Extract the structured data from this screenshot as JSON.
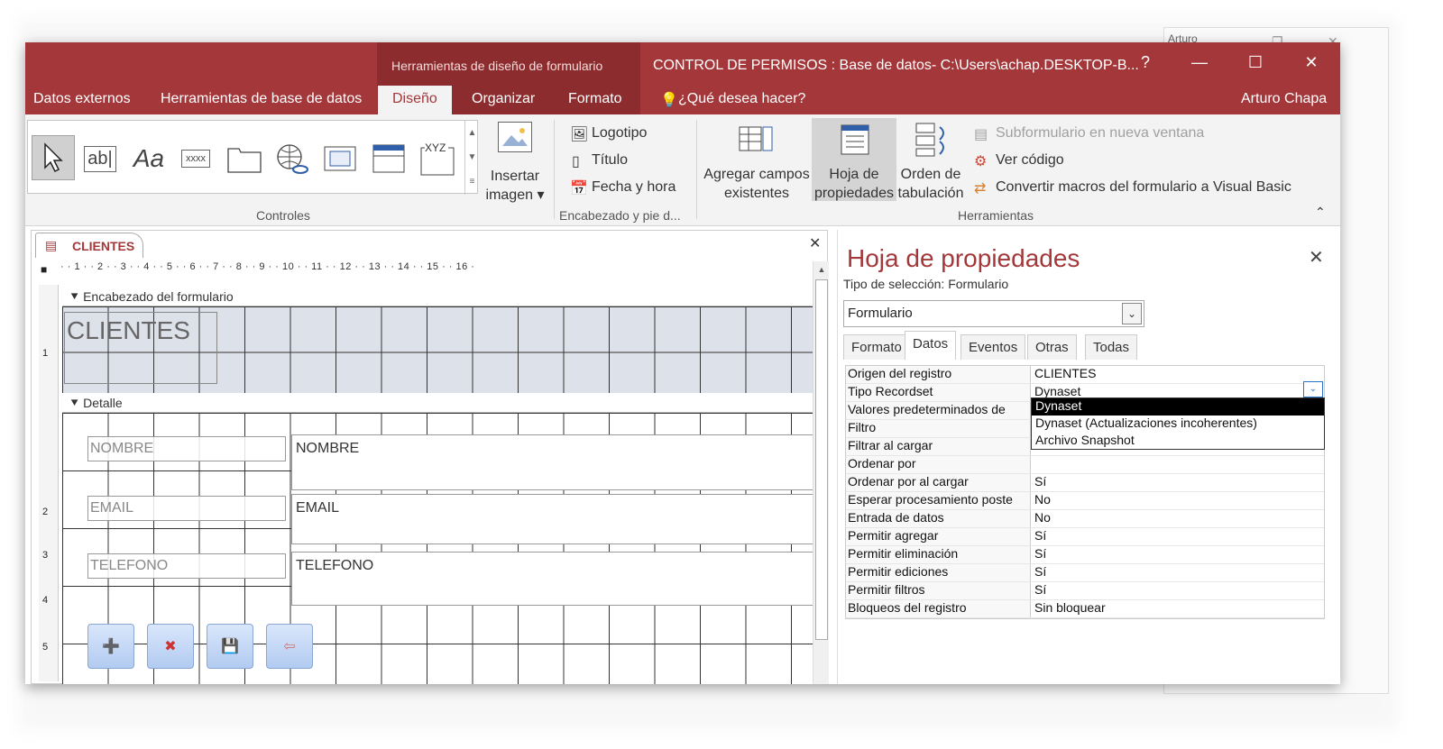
{
  "background_window": {
    "title": "Arturo",
    "controls": [
      "—",
      "❐",
      "✕"
    ]
  },
  "titlebar": {
    "context_label": "Herramientas de diseño de formulario",
    "document_title": "CONTROL DE PERMISOS : Base de datos- C:\\Users\\achap.DESKTOP-B...",
    "help": "?",
    "minimize": "—",
    "maximize": "☐",
    "close": "✕"
  },
  "tabs": {
    "datos_externos": "Datos externos",
    "herramientas_bd": "Herramientas de base de datos",
    "diseno": "Diseño",
    "organizar": "Organizar",
    "formato": "Formato",
    "que_desea": "¿Qué desea hacer?",
    "user": "Arturo Chapa"
  },
  "ribbon": {
    "controles_label": "Controles",
    "textbox_glyph": "ab|",
    "label_glyph": "Aa",
    "button_glyph": "xxxx",
    "xyz_glyph": "XYZ",
    "insertar_imagen": "Insertar imagen ▾",
    "logotipo": "Logotipo",
    "titulo": "Título",
    "fecha_hora": "Fecha y hora",
    "encabezado_label": "Encabezado y pie d...",
    "agregar_campos": "Agregar campos existentes",
    "hoja_propiedades": "Hoja de propiedades",
    "orden_tabulacion": "Orden de tabulación",
    "subformulario": "Subformulario en nueva ventana",
    "ver_codigo": "Ver código",
    "convertir_macros": "Convertir macros del formulario a Visual Basic",
    "herramientas_label": "Herramientas",
    "collapse": "⌃"
  },
  "designer": {
    "tab_label": "CLIENTES",
    "close": "✕",
    "ruler": "· · 1 · · 2 · · 3 · · 4 · · 5 · · 6 · · 7 · · 8 · · 9 · · 10 · · 11 · · 12 · · 13 · · 14 · · 15 · · 16 ·",
    "ruler_corner": "■",
    "header_section": "Encabezado del formulario",
    "form_title": "CLIENTES",
    "detail_section": "Detalle",
    "fields": [
      {
        "label": "NOMBRE",
        "box": "NOMBRE"
      },
      {
        "label": "EMAIL",
        "box": "EMAIL"
      },
      {
        "label": "TELEFONO",
        "box": "TELEFONO"
      }
    ],
    "vruler": [
      "1",
      "2",
      "3",
      "4",
      "5"
    ]
  },
  "property_sheet": {
    "title": "Hoja de propiedades",
    "close": "✕",
    "selection_type_label": "Tipo de selección:",
    "selection_type_value": "Formulario",
    "combo_value": "Formulario",
    "tabs": [
      "Formato",
      "Datos",
      "Eventos",
      "Otras",
      "Todas"
    ],
    "active_tab": "Datos",
    "rows": [
      {
        "name": "Origen del registro",
        "value": "CLIENTES"
      },
      {
        "name": "Tipo Recordset",
        "value": "Dynaset"
      },
      {
        "name": "Valores predeterminados de",
        "value": ""
      },
      {
        "name": "Filtro",
        "value": ""
      },
      {
        "name": "Filtrar al cargar",
        "value": ""
      },
      {
        "name": "Ordenar por",
        "value": ""
      },
      {
        "name": "Ordenar por al cargar",
        "value": "Sí"
      },
      {
        "name": "Esperar procesamiento poste",
        "value": "No"
      },
      {
        "name": "Entrada de datos",
        "value": "No"
      },
      {
        "name": "Permitir agregar",
        "value": "Sí"
      },
      {
        "name": "Permitir eliminación",
        "value": "Sí"
      },
      {
        "name": "Permitir ediciones",
        "value": "Sí"
      },
      {
        "name": "Permitir filtros",
        "value": "Sí"
      },
      {
        "name": "Bloqueos del registro",
        "value": "Sin bloquear"
      }
    ],
    "dropdown_options": [
      "Dynaset",
      "Dynaset (Actualizaciones incoherentes)",
      "Archivo Snapshot"
    ]
  },
  "colors": {
    "accent": "#a4373a",
    "context_band": "#8c2c2e",
    "header_fill": "#dde1ea",
    "button_fill": "#c5d8f6"
  }
}
